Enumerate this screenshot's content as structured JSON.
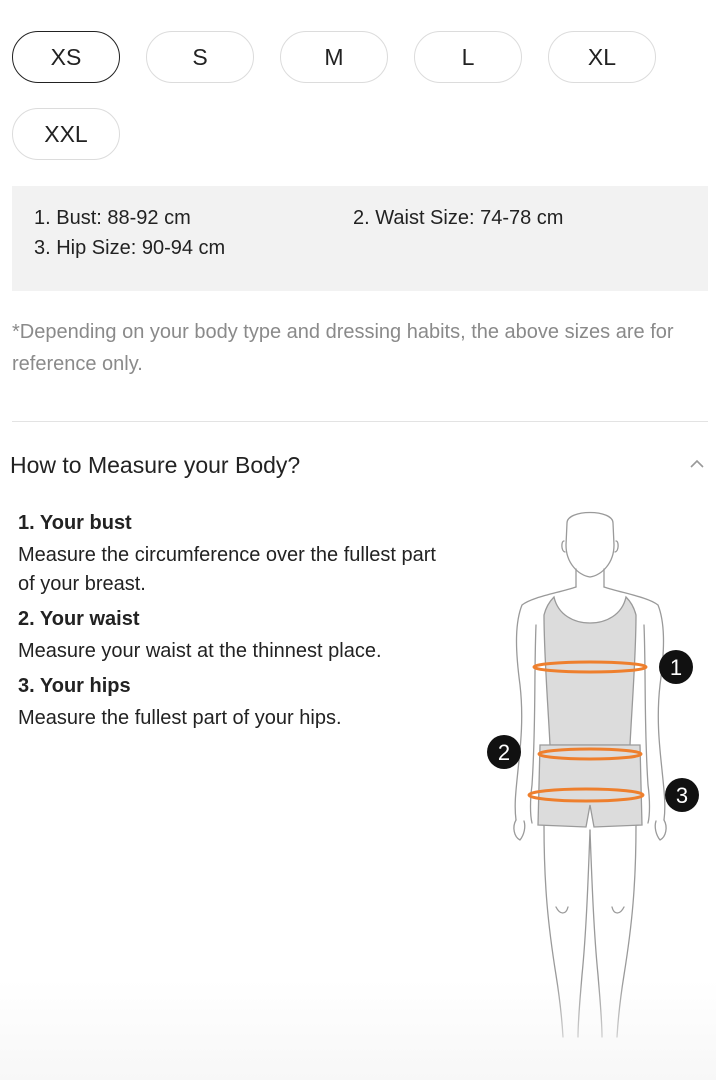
{
  "sizes": {
    "options": [
      "XS",
      "S",
      "M",
      "L",
      "XL",
      "XXL"
    ],
    "selected": "XS"
  },
  "measurements": {
    "bust": "1. Bust: 88-92 cm",
    "waist": "2. Waist Size: 74-78 cm",
    "hip": "3. Hip Size: 90-94 cm"
  },
  "note": "*Depending on your body type and dressing habits, the above sizes are for reference only.",
  "how_to_measure": {
    "title": "How to Measure your Body?",
    "items": [
      {
        "heading": "1. Your bust",
        "text": "Measure the circumference over the fullest part of your breast."
      },
      {
        "heading": "2. Your waist",
        "text": "Measure your waist at the thinnest place."
      },
      {
        "heading": "3. Your hips",
        "text": "Measure the fullest part of your hips."
      }
    ],
    "figure_markers": [
      "1",
      "2",
      "3"
    ]
  },
  "colors": {
    "accent": "#ee7f2d",
    "border": "#dcdcdc",
    "panel_bg": "#f2f2f2",
    "muted_text": "#8a8a8a"
  },
  "icons": {
    "collapse": "chevron-up-icon",
    "figure": "body-measurement-figure"
  }
}
